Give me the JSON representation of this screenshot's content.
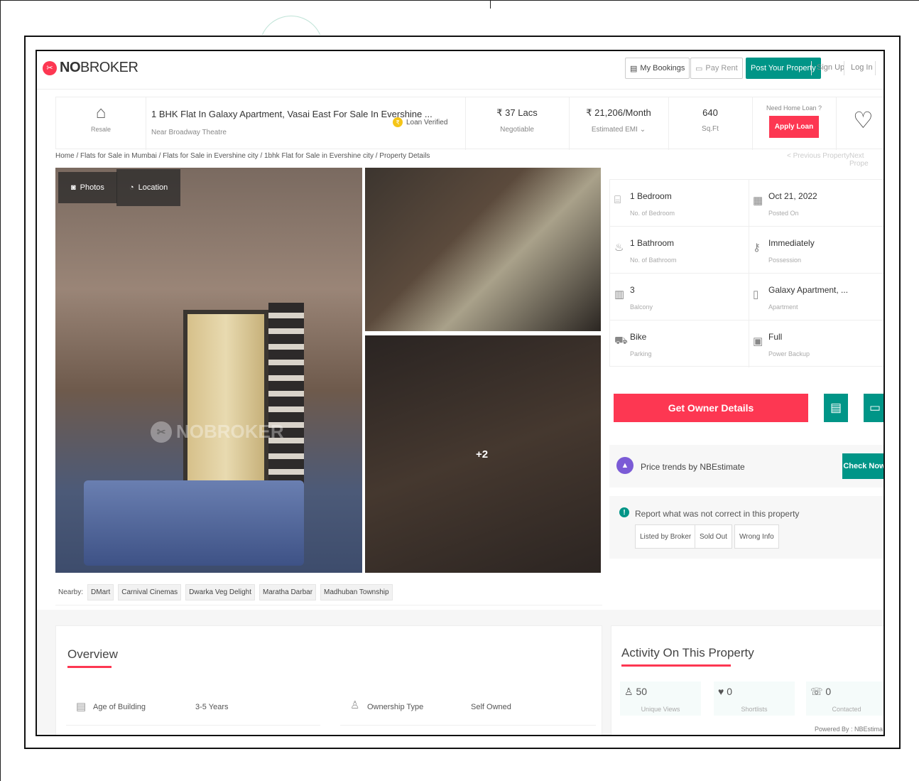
{
  "header": {
    "logo_text_bold": "NO",
    "logo_text": "BROKER",
    "my_bookings": "My Bookings",
    "pay_rent": "Pay Rent",
    "post_property": "Post Your Property",
    "sign_up": "Sign Up",
    "log_in": "Log In"
  },
  "summary": {
    "type_label": "Resale",
    "title": "1 BHK Flat In Galaxy Apartment, Vasai East For Sale In Evershine ...",
    "subtitle": "Near Broadway Theatre",
    "loan_verified": "Loan Verified",
    "price": "₹ 37 Lacs",
    "price_note": "Negotiable",
    "emi": "₹ 21,206/Month",
    "emi_note": "Estimated EMI",
    "area": "640",
    "area_unit": "Sq.Ft",
    "loan_prompt": "Need Home Loan ?",
    "apply_loan": "Apply Loan"
  },
  "breadcrumb": "Home / Flats for Sale in Mumbai / Flats for Sale in Evershine city / 1bhk Flat for Sale in Evershine city / Property Details",
  "pager": {
    "previous": "< Previous Property",
    "next": "Next Prope"
  },
  "gallery": {
    "photos_tab": "Photos",
    "location_tab": "Location",
    "more_count": "+2",
    "watermark": "NOBROKER"
  },
  "nearby": {
    "label": "Nearby:",
    "places": [
      "DMart",
      "Carnival Cinemas",
      "Dwarka Veg Delight",
      "Maratha Darbar",
      "Madhuban Township"
    ]
  },
  "details": [
    {
      "value": "1 Bedroom",
      "label": "No. of Bedroom",
      "icon": "bed-icon"
    },
    {
      "value": "Oct 21, 2022",
      "label": "Posted On",
      "icon": "calendar-icon"
    },
    {
      "value": "1 Bathroom",
      "label": "No. of Bathroom",
      "icon": "bathtub-icon"
    },
    {
      "value": "Immediately",
      "label": "Possession",
      "icon": "key-icon"
    },
    {
      "value": "3",
      "label": "Balcony",
      "icon": "balcony-icon"
    },
    {
      "value": "Galaxy Apartment, ...",
      "label": "Apartment",
      "icon": "building-icon"
    },
    {
      "value": "Bike",
      "label": "Parking",
      "icon": "car-icon"
    },
    {
      "value": "Full",
      "label": "Power Backup",
      "icon": "battery-icon"
    }
  ],
  "actions": {
    "get_owner": "Get Owner Details"
  },
  "price_trend": {
    "text": "Price trends by NBEstimate",
    "button": "Check Now"
  },
  "report": {
    "text": "Report what was not correct in this property",
    "options": [
      "Listed by Broker",
      "Sold Out",
      "Wrong Info"
    ]
  },
  "overview": {
    "title": "Overview",
    "rows": [
      {
        "label": "Age of Building",
        "value": "3-5 Years"
      },
      {
        "label": "Ownership Type",
        "value": "Self Owned"
      }
    ]
  },
  "activity": {
    "title": "Activity On This Property",
    "stats": [
      {
        "value": "50",
        "label": "Unique Views"
      },
      {
        "value": "0",
        "label": "Shortlists"
      },
      {
        "value": "0",
        "label": "Contacted"
      }
    ],
    "powered_by": "Powered By : NBEstima"
  },
  "colors": {
    "brand_red": "#fd3752",
    "brand_green": "#009587"
  }
}
